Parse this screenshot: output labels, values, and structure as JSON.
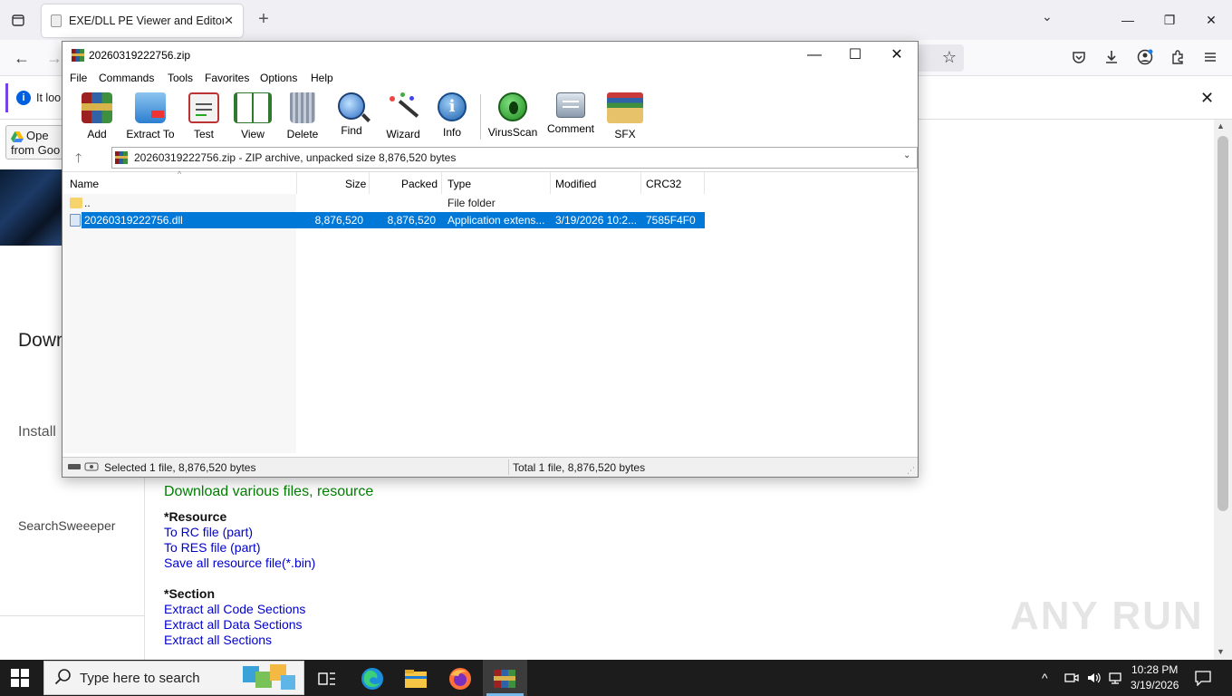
{
  "browser": {
    "tab_title": "EXE/DLL PE Viewer and Editor",
    "notification_text": "It loo"
  },
  "web": {
    "open_drive_label": "Ope from Goo",
    "download_heading_left": "Down",
    "install_text": "Install",
    "search_sweeper": "SearchSweeeper",
    "download_heading": "Download various files, resource",
    "resource_heading": "*Resource",
    "resource_links": [
      "To RC file (part)",
      "To RES file (part)",
      "Save all resource file(*.bin)"
    ],
    "section_heading": "*Section",
    "section_links": [
      "Extract all Code Sections",
      "Extract all Data Sections",
      "Extract all Sections"
    ],
    "watermark": "ANY RUN"
  },
  "winrar": {
    "title": "20260319222756.zip",
    "menu": [
      "File",
      "Commands",
      "Tools",
      "Favorites",
      "Options",
      "Help"
    ],
    "toolbar": [
      "Add",
      "Extract To",
      "Test",
      "View",
      "Delete",
      "Find",
      "Wizard",
      "Info",
      "VirusScan",
      "Comment",
      "SFX"
    ],
    "address": "20260319222756.zip - ZIP archive, unpacked size 8,876,520 bytes",
    "columns": [
      "Name",
      "Size",
      "Packed",
      "Type",
      "Modified",
      "CRC32"
    ],
    "rows": [
      {
        "name": "..",
        "size": "",
        "packed": "",
        "type": "File folder",
        "modified": "",
        "crc": ""
      },
      {
        "name": "20260319222756.dll",
        "size": "8,876,520",
        "packed": "8,876,520",
        "type": "Application extens...",
        "modified": "3/19/2026 10:2...",
        "crc": "7585F4F0"
      }
    ],
    "status_selected": "Selected 1 file, 8,876,520 bytes",
    "status_total": "Total 1 file, 8,876,520 bytes"
  },
  "taskbar": {
    "search_placeholder": "Type here to search",
    "time": "10:28 PM",
    "date": "3/19/2026"
  },
  "colors": {
    "selection": "#0078d7",
    "link": "#0000cc",
    "download_green": "#008000",
    "taskbar": "#1c1c1c"
  }
}
